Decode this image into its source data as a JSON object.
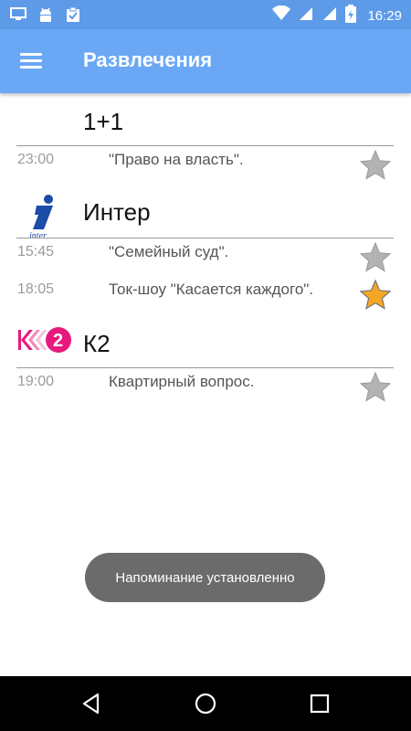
{
  "status_bar": {
    "time": "16:29",
    "left_icons": [
      "monitor-icon",
      "android-icon",
      "clipboard-check-icon"
    ],
    "right_icons": [
      "wifi-icon",
      "signal-icon",
      "signal-icon",
      "battery-icon"
    ]
  },
  "app_bar": {
    "title": "Развлечения",
    "menu_icon": "hamburger-menu-icon"
  },
  "channels": [
    {
      "name": "1+1",
      "shows": [
        {
          "time": "23:00",
          "title": "\"Право на власть\".",
          "favorite": false
        }
      ]
    },
    {
      "name": "Интер",
      "logo_text": "inter",
      "shows": [
        {
          "time": "15:45",
          "title": "\"Семейный суд\".",
          "favorite": false
        },
        {
          "time": "18:05",
          "title": "Ток-шоу \"Касается каждого\".",
          "favorite": true
        }
      ]
    },
    {
      "name": "К2",
      "shows": [
        {
          "time": "19:00",
          "title": "Квартирный вопрос.",
          "favorite": false
        }
      ]
    }
  ],
  "toast": {
    "message": "Напоминание установленно"
  },
  "nav_bar": {
    "icons": [
      "back-icon",
      "home-icon",
      "recents-icon"
    ]
  },
  "colors": {
    "status_bar": "#5d9be9",
    "app_bar": "#6aa8f5",
    "star_active": "#f5a623",
    "star_inactive": "#b3b3b3",
    "toast_bg": "#6b6b6b"
  }
}
